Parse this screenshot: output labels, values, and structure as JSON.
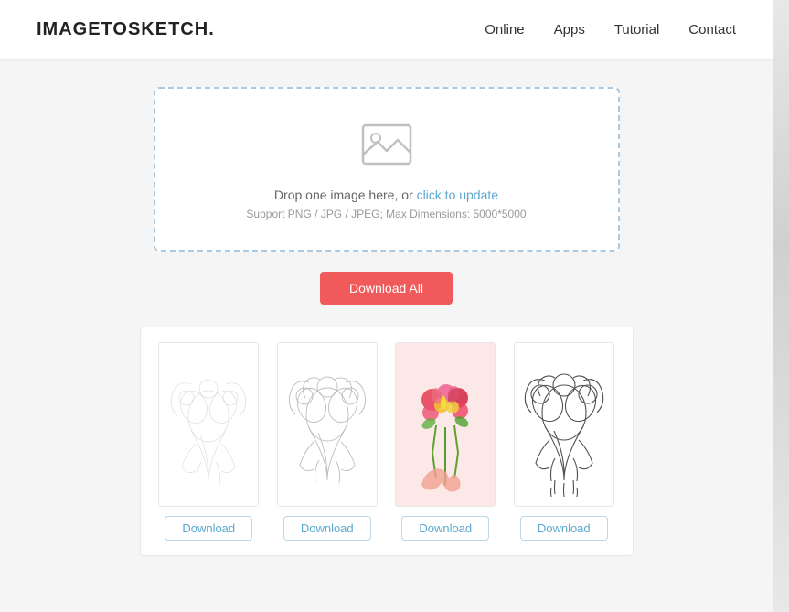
{
  "header": {
    "logo": "IMAGETOSKETCH.",
    "nav": {
      "online": "Online",
      "apps": "Apps",
      "tutorial": "Tutorial",
      "contact": "Contact"
    }
  },
  "dropzone": {
    "main_text": "Drop one image here, or ",
    "link_text": "click to update",
    "sub_text": "Support PNG / JPG / JPEG; Max Dimensions: 5000*5000"
  },
  "buttons": {
    "download_all": "Download All",
    "download": "Download"
  },
  "gallery": {
    "items": [
      {
        "id": 1,
        "type": "sketch-light",
        "colored": false
      },
      {
        "id": 2,
        "type": "sketch-medium",
        "colored": false
      },
      {
        "id": 3,
        "type": "sketch-colored",
        "colored": true
      },
      {
        "id": 4,
        "type": "sketch-dark",
        "colored": false
      }
    ]
  }
}
